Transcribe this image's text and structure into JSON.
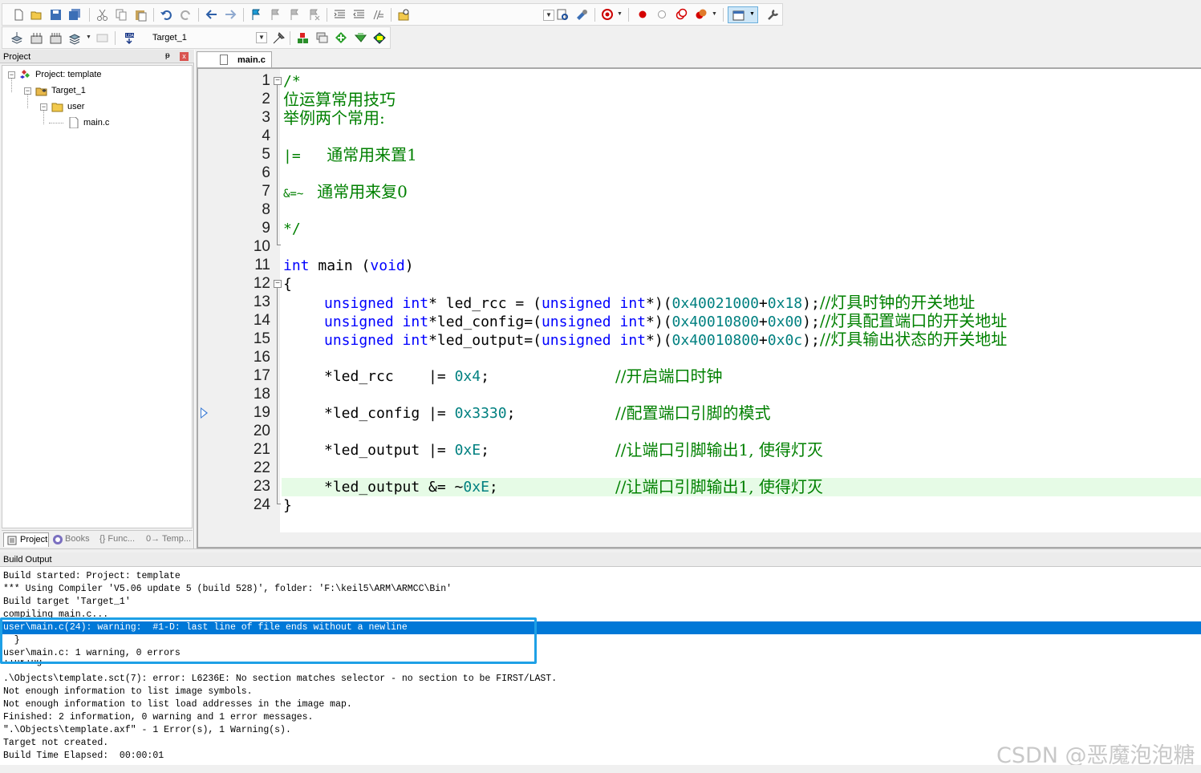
{
  "toolbar": {
    "target_name": "Target_1"
  },
  "project_panel": {
    "title": "Project",
    "pin": "ᵽ",
    "close": "x",
    "tree": [
      {
        "label": "Project: template"
      },
      {
        "label": "Target_1"
      },
      {
        "label": "user"
      },
      {
        "label": "main.c"
      }
    ],
    "tabs": [
      "Project",
      "Books",
      "{} Func...",
      "0→ Temp..."
    ]
  },
  "editor": {
    "tab_label": "main.c",
    "line_numbers": [
      "1",
      "2",
      "3",
      "4",
      "5",
      "6",
      "7",
      "8",
      "9",
      "10",
      "11",
      "12",
      "13",
      "14",
      "15",
      "16",
      "17",
      "18",
      "19",
      "20",
      "21",
      "22",
      "23",
      "24"
    ],
    "fold_markers": {
      "open": "−",
      "close": "−"
    }
  },
  "code": {
    "l1": "/*",
    "l2": "位运算常用技巧",
    "l3": "举例两个常用:",
    "l5a": "|=   ",
    "l5b": "通常用来置1",
    "l7a": "&=~  ",
    "l7b": "通常用来复0",
    "l9": "*/",
    "l11_kw": "int",
    "l11_mid": " main ",
    "l11_paren_open": "(",
    "l11_void": "void",
    "l11_paren_close": ")",
    "l12": "{",
    "l13_kw1": "unsigned",
    "l13_kw2": "int",
    "l13_mid": "* led_rcc = ",
    "l13_cast_open": "(",
    "l13_kw3": "unsigned",
    "l13_kw4": "int",
    "l13_cast_close": "*)",
    "l13_paren": "(",
    "l13_num1": "0x40021000",
    "l13_plus": "+",
    "l13_num2": "0x18",
    "l13_end": ");",
    "l13_cmt": "//灯具时钟的开关地址",
    "l14_kw1": "unsigned",
    "l14_kw2": "int",
    "l14_mid": "*led_config=",
    "l14_cast_open": "(",
    "l14_kw3": "unsigned",
    "l14_kw4": "int",
    "l14_cast_close": "*)",
    "l14_paren": "(",
    "l14_num1": "0x40010800",
    "l14_plus": "+",
    "l14_num2": "0x00",
    "l14_end": ");",
    "l14_cmt": "//灯具配置端口的开关地址",
    "l15_kw1": "unsigned",
    "l15_kw2": "int",
    "l15_mid": "*led_output=",
    "l15_cast_open": "(",
    "l15_kw3": "unsigned",
    "l15_kw4": "int",
    "l15_cast_close": "*)",
    "l15_paren": "(",
    "l15_num1": "0x40010800",
    "l15_plus": "+",
    "l15_num2": "0x0c",
    "l15_end": ");",
    "l15_cmt": "//灯具输出状态的开关地址",
    "l17_code": "*led_rcc    |= ",
    "l17_num": "0x4",
    "l17_end": ";",
    "l17_cmt": "//开启端口时钟",
    "l19_code": "*led_config |= ",
    "l19_num": "0x3330",
    "l19_end": ";",
    "l19_cmt": "//配置端口引脚的模式",
    "l21_code": "*led_output |= ",
    "l21_num": "0xE",
    "l21_end": ";",
    "l21_cmt": "//让端口引脚输出1, 使得灯灭",
    "l23_code": "*led_output &= ~",
    "l23_num": "0xE",
    "l23_end": ";",
    "l23_cmt": "//让端口引脚输出1, 使得灯灭",
    "l24": "}"
  },
  "build_output": {
    "title": "Build Output",
    "lines": [
      "Build started: Project: template",
      "*** Using Compiler 'V5.06 update 5 (build 528)', folder: 'F:\\keil5\\ARM\\ARMCC\\Bin'",
      "Build target 'Target_1'",
      "compiling main.c...",
      "user\\main.c(24): warning:  #1-D: last line of file ends without a newline",
      "  }",
      "user\\main.c: 1 warning, 0 errors",
      "linking...",
      ".\\Objects\\template.sct(7): error: L6236E: No section matches selector - no section to be FIRST/LAST.",
      "Not enough information to list image symbols.",
      "Not enough information to list load addresses in the image map.",
      "Finished: 2 information, 0 warning and 1 error messages.",
      "\".\\Objects\\template.axf\" - 1 Error(s), 1 Warning(s).",
      "Target not created.",
      "Build Time Elapsed:  00:00:01"
    ]
  },
  "watermark": "CSDN @恶魔泡泡糖",
  "colors": {
    "keyword": "#0000ff",
    "number": "#008080",
    "comment": "#008000",
    "selection": "#0078d7",
    "highlight_box": "#1ea0e6",
    "current_line": "#e6fbe6"
  }
}
